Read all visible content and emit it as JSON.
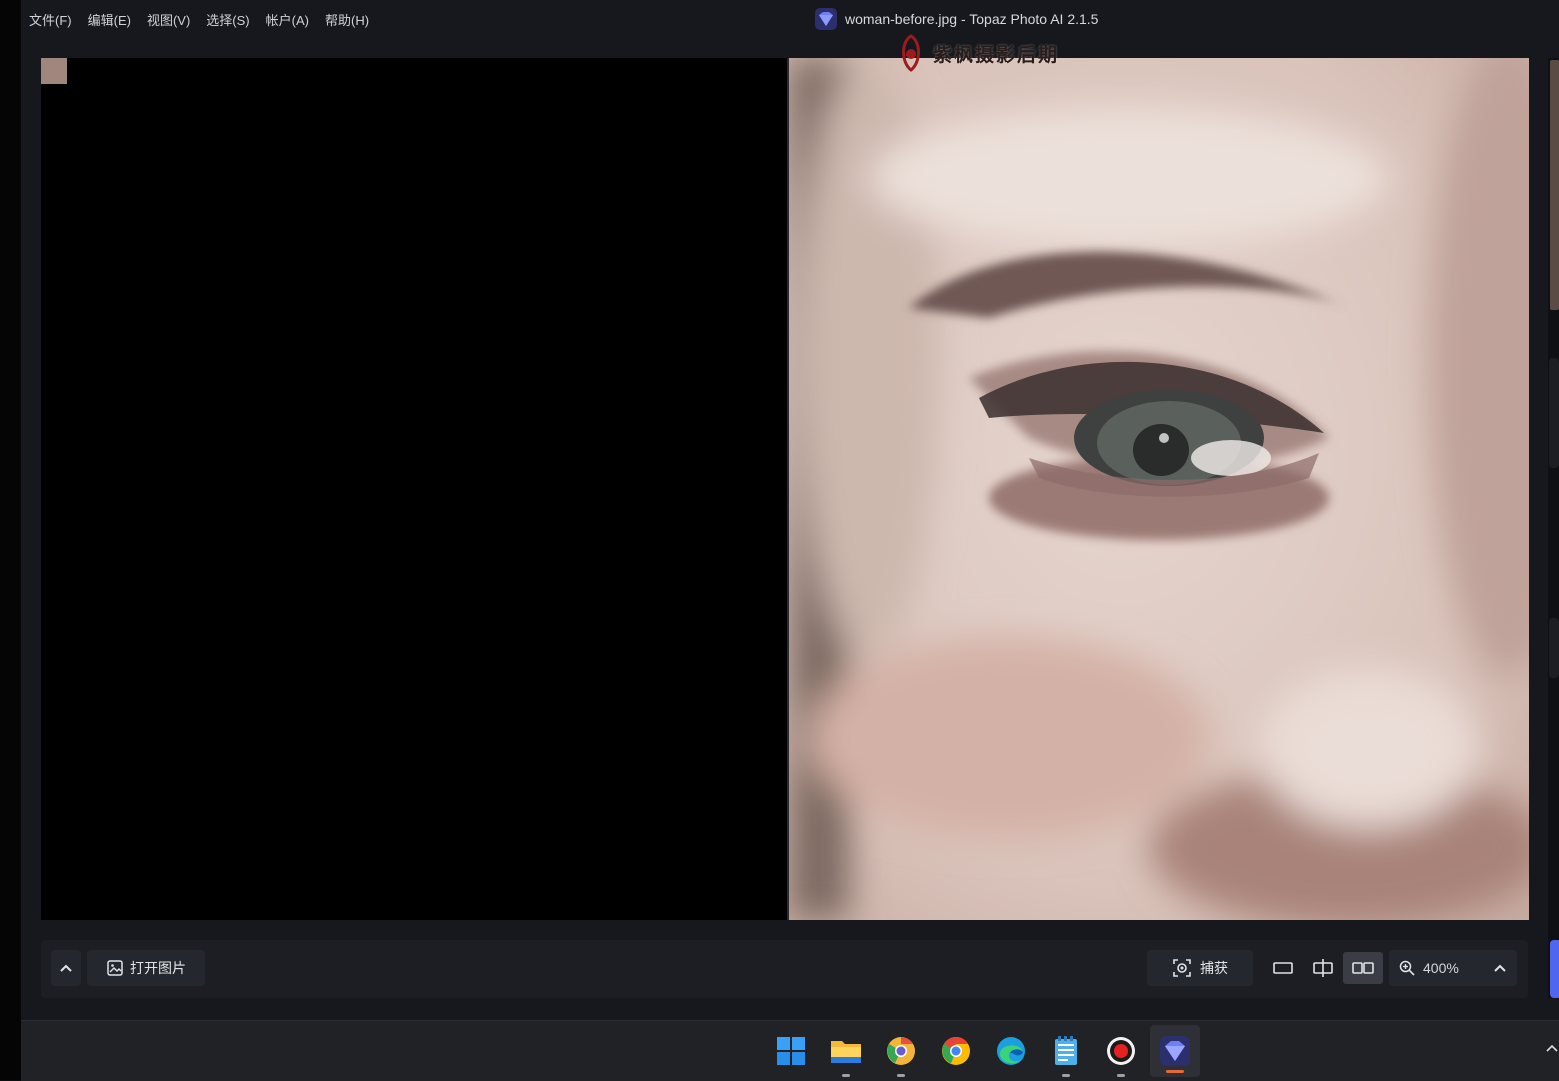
{
  "menu": {
    "items": [
      "文件(F)",
      "编辑(E)",
      "视图(V)",
      "选择(S)",
      "帐户(A)",
      "帮助(H)"
    ]
  },
  "window": {
    "title": "woman-before.jpg - Topaz Photo AI 2.1.5"
  },
  "watermark": {
    "text": "紫枫摄影后期"
  },
  "toolbar": {
    "open_label": "打开图片",
    "capture_label": "捕获",
    "zoom_value": "400%",
    "active_view": "side-by-side"
  },
  "colors": {
    "accent": "#4f66f1",
    "app_bg": "#16181d",
    "toolbar_bg": "#1c1e23"
  },
  "taskbar": {
    "icons": [
      "windows-start-icon",
      "file-explorer-icon",
      "chrome-canary-icon",
      "chrome-icon",
      "edge-icon",
      "notepad-icon",
      "screen-recorder-icon",
      "topaz-photo-ai-icon"
    ]
  }
}
